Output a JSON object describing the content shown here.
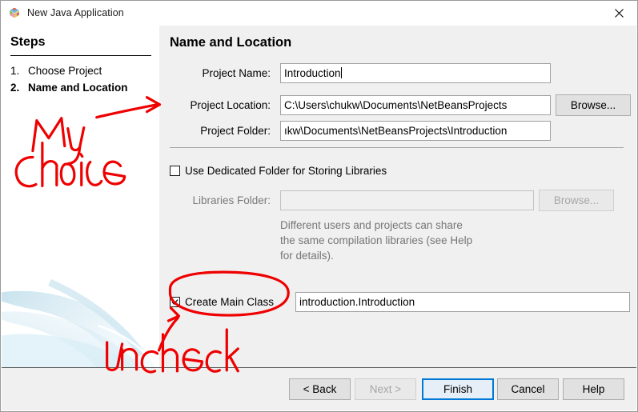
{
  "window": {
    "title": "New Java Application",
    "icon": "netbeans-cube-icon",
    "close_label": "✕"
  },
  "steps": {
    "heading": "Steps",
    "items": [
      {
        "num": "1.",
        "label": "Choose Project",
        "current": false
      },
      {
        "num": "2.",
        "label": "Name and Location",
        "current": true
      }
    ]
  },
  "main": {
    "title": "Name and Location",
    "project_name": {
      "label": "Project Name:",
      "value": "Introduction",
      "placeholder": ""
    },
    "project_location": {
      "label": "Project Location:",
      "value": "C:\\Users\\chukw\\Documents\\NetBeansProjects",
      "placeholder": "",
      "browse_label": "Browse..."
    },
    "project_folder": {
      "label": "Project Folder:",
      "value": "ıkw\\Documents\\NetBeansProjects\\Introduction",
      "placeholder": ""
    },
    "dedicated_folder": {
      "label": "Use Dedicated Folder for Storing Libraries",
      "checked": false
    },
    "libraries_folder": {
      "label": "Libraries Folder:",
      "value": "",
      "placeholder": "",
      "browse_label": "Browse...",
      "enabled": false
    },
    "libraries_hint": "Different users and projects can share the same compilation libraries (see Help for details).",
    "create_main_class": {
      "label": "Create Main Class",
      "checked": true,
      "value": "introduction.Introduction",
      "placeholder": ""
    }
  },
  "buttons": {
    "back": "< Back",
    "next": "Next >",
    "finish": "Finish",
    "cancel": "Cancel",
    "help": "Help"
  },
  "annotations": {
    "color": "#ef0000",
    "my_choice": "My\nchoice",
    "my_choice_line1": "My",
    "my_choice_line2": "choice",
    "uncheck": "Uncheck"
  },
  "colors": {
    "panel": "#f0f0f0",
    "accent": "#0078d7",
    "annotation": "#ef0000",
    "hint_text": "#767676"
  }
}
